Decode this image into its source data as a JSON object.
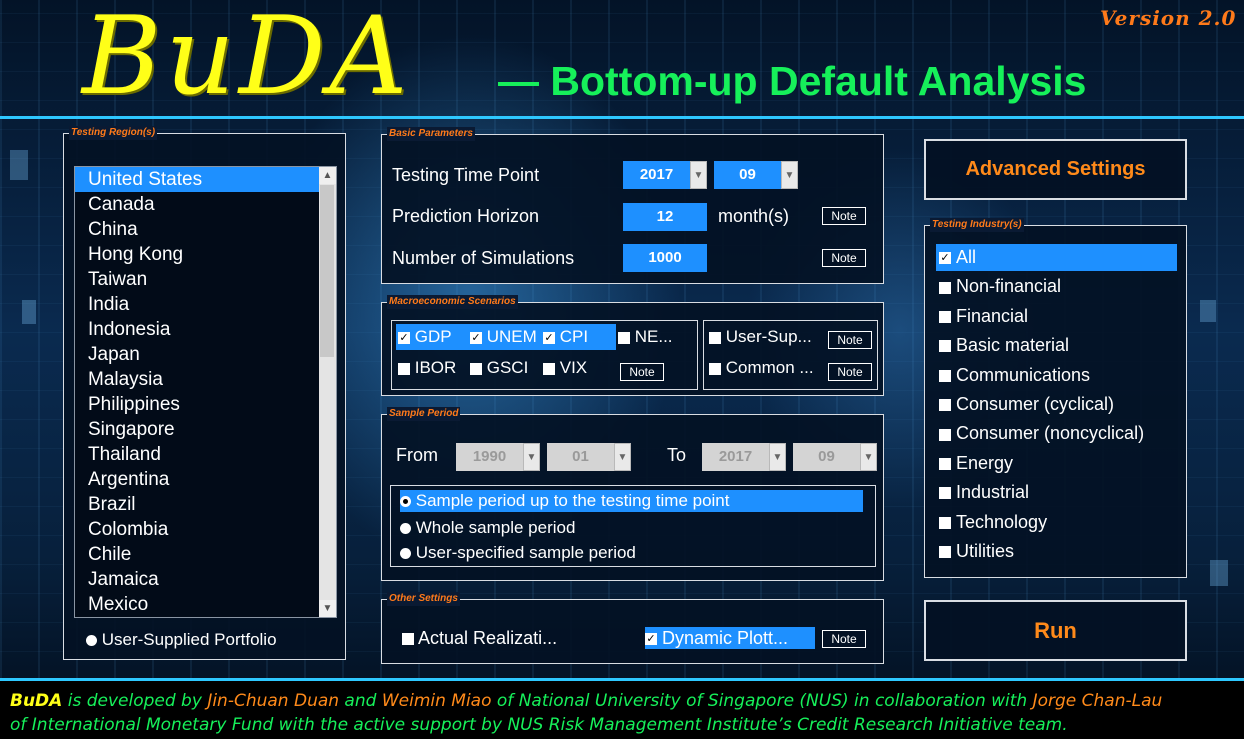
{
  "header": {
    "logo": "BuDA",
    "tagline": "— Bottom-up Default Analysis",
    "version": "Version 2.0"
  },
  "regions": {
    "title": "Testing Region(s)",
    "items": [
      "United States",
      "Canada",
      "China",
      "Hong Kong",
      "Taiwan",
      "India",
      "Indonesia",
      "Japan",
      "Malaysia",
      "Philippines",
      "Singapore",
      "Thailand",
      "Argentina",
      "Brazil",
      "Colombia",
      "Chile",
      "Jamaica",
      "Mexico"
    ],
    "selected": "United States",
    "portfolio_option": "User-Supplied Portfolio"
  },
  "basic": {
    "title": "Basic Parameters",
    "time_point_label": "Testing Time Point",
    "year": "2017",
    "month": "09",
    "horizon_label": "Prediction Horizon",
    "horizon_value": "12",
    "horizon_unit": "month(s)",
    "sims_label": "Number of Simulations",
    "sims_value": "1000",
    "note": "Note"
  },
  "macro": {
    "title": "Macroeconomic Scenarios",
    "row1": [
      {
        "label": "GDP",
        "checked": true
      },
      {
        "label": "UNEM",
        "checked": true
      },
      {
        "label": "CPI",
        "checked": true
      },
      {
        "label": "NE...",
        "checked": false
      }
    ],
    "row2": [
      {
        "label": "IBOR",
        "checked": false
      },
      {
        "label": "GSCI",
        "checked": false
      },
      {
        "label": "VIX",
        "checked": false
      }
    ],
    "right": [
      {
        "label": "User-Sup...",
        "checked": false
      },
      {
        "label": "Common ...",
        "checked": false
      }
    ],
    "note": "Note"
  },
  "sample": {
    "title": "Sample Period",
    "from_label": "From",
    "from_year": "1990",
    "from_month": "01",
    "to_label": "To",
    "to_year": "2017",
    "to_month": "09",
    "options": [
      "Sample period up to the testing time point",
      "Whole sample period",
      "User-specified sample period"
    ],
    "selected_index": 0
  },
  "other": {
    "title": "Other Settings",
    "actual_label": "Actual Realizati...",
    "actual_checked": false,
    "dynamic_label": "Dynamic Plott...",
    "dynamic_checked": true,
    "note": "Note"
  },
  "buttons": {
    "advanced": "Advanced Settings",
    "run": "Run"
  },
  "industry": {
    "title": "Testing Industry(s)",
    "items": [
      {
        "label": "All",
        "checked": true
      },
      {
        "label": "Non-financial",
        "checked": false
      },
      {
        "label": "Financial",
        "checked": false
      },
      {
        "label": "Basic material",
        "checked": false
      },
      {
        "label": "Communications",
        "checked": false
      },
      {
        "label": "Consumer (cyclical)",
        "checked": false
      },
      {
        "label": "Consumer (noncyclical)",
        "checked": false
      },
      {
        "label": "Energy",
        "checked": false
      },
      {
        "label": "Industrial",
        "checked": false
      },
      {
        "label": "Technology",
        "checked": false
      },
      {
        "label": "Utilities",
        "checked": false
      }
    ]
  },
  "footer": {
    "buda": "BuDA",
    "t1": " is developed by ",
    "p1": "Jin-Chuan Duan",
    "t2": " and ",
    "p2": "Weimin  Miao",
    "t3": " of National University of Singapore (NUS) in collaboration with ",
    "p3": "Jorge Chan-Lau",
    "line2": "of International Monetary Fund with the active support by NUS Risk Management Institute’s Credit Research Initiative team."
  },
  "colors": {
    "accent_blue": "#1e90ff",
    "title_orange": "#ff7a1a",
    "logo_yellow": "#ffff18",
    "tagline_green": "#16f05a"
  }
}
